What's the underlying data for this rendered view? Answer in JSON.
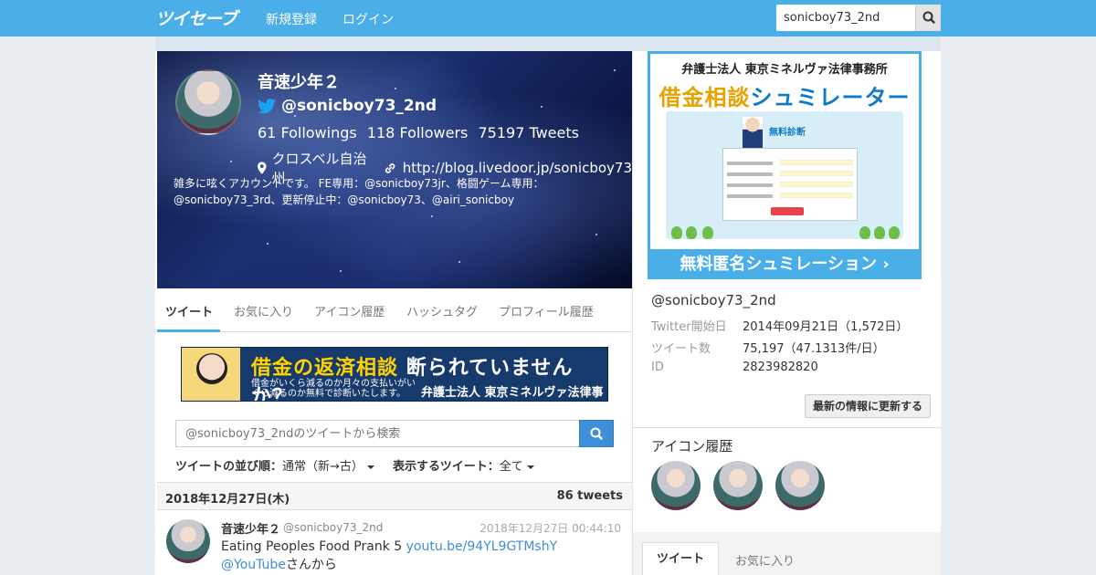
{
  "nav": {
    "logo": "ツイセーブ",
    "signup": "新規登録",
    "login": "ログイン",
    "search_value": "sonicboy73_2nd"
  },
  "profile": {
    "name": "音速少年２",
    "handle": "@sonicboy73_2nd",
    "followings": "61 Followings",
    "followers": "118 Followers",
    "tweets": "75197 Tweets",
    "location": "クロスベル自治州",
    "url": "http://blog.livedoor.jp/sonicboy73",
    "description": "雑多に呟くアカウントです。 FE専用：@sonicboy73jr、格闘ゲーム専用：@sonicboy73_3rd、更新停止中：@sonicboy73、@airi_sonicboy"
  },
  "tabs": [
    "ツイート",
    "お気に入り",
    "アイコン履歴",
    "ハッシュタグ",
    "プロフィール履歴"
  ],
  "ad_banner": {
    "line1a": "借金の返済相談",
    "line1b": "断られていませんか？",
    "line2": "借金がいくら減るのか月々の支払いがいくら減るのか無料で診断いたします。",
    "firm": "弁護士法人 東京ミネルヴァ法律事務所"
  },
  "tweet_search": {
    "placeholder": "@sonicboy73_2ndのツイートから検索"
  },
  "sort": {
    "order_label": "ツイートの並び順：",
    "order_value": "通常（新→古）",
    "show_label": "表示するツイート：",
    "show_value": "全て"
  },
  "datebar": {
    "date": "2018年12月27日(木)",
    "count": "86 tweets"
  },
  "tweet": {
    "name": "音速少年２",
    "handle": "@sonicboy73_2nd",
    "time": "2018年12月27日 00:44:10",
    "text_pre": "Eating Peoples Food Prank 5 ",
    "link1": "youtu.be/94YL9GTMshY",
    "link2": "@YouTube",
    "text_post": "さんから"
  },
  "side_ad": {
    "firm": "弁護士法人 東京ミネルヴァ法律事務所",
    "title_a": "借金相談",
    "title_b": "シュミレーター",
    "panel_title": "無料診断",
    "bottom": "無料匿名シュミレーション ›"
  },
  "info": {
    "handle": "@sonicboy73_2nd",
    "rows": [
      {
        "label": "Twitter開始日",
        "value": "2014年09月21日（1,572日）"
      },
      {
        "label": "ツイート数",
        "value": "75,197（47.1313件/日）"
      },
      {
        "label": "ID",
        "value": "2823982820"
      }
    ],
    "update_button": "最新の情報に更新する"
  },
  "icon_history": {
    "title": "アイコン履歴"
  },
  "side_tabs": [
    "ツイート",
    "お気に入り"
  ],
  "colors": {
    "nav_bg": "#4aaee8",
    "accent": "#3f8fd8",
    "twitter": "#1da1f2"
  }
}
